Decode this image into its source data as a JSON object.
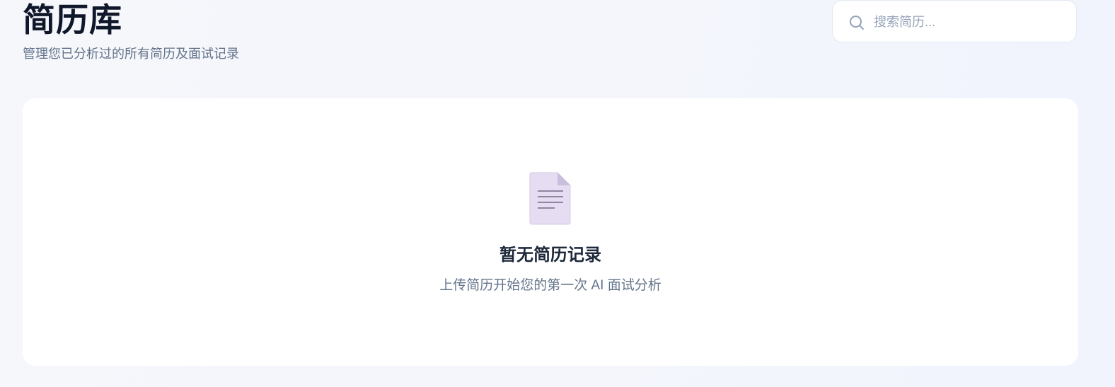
{
  "header": {
    "title": "简历库",
    "subtitle": "管理您已分析过的所有简历及面试记录"
  },
  "search": {
    "placeholder": "搜索简历...",
    "value": "",
    "icon": "search-icon"
  },
  "empty_state": {
    "icon": "document-icon",
    "title": "暂无简历记录",
    "description": "上传简历开始您的第一次 AI 面试分析"
  },
  "colors": {
    "title": "#0f172a",
    "muted": "#64748b",
    "card_bg": "#ffffff",
    "page_bg": "#f4f6fc",
    "doc_icon": "#e6ddf2"
  }
}
